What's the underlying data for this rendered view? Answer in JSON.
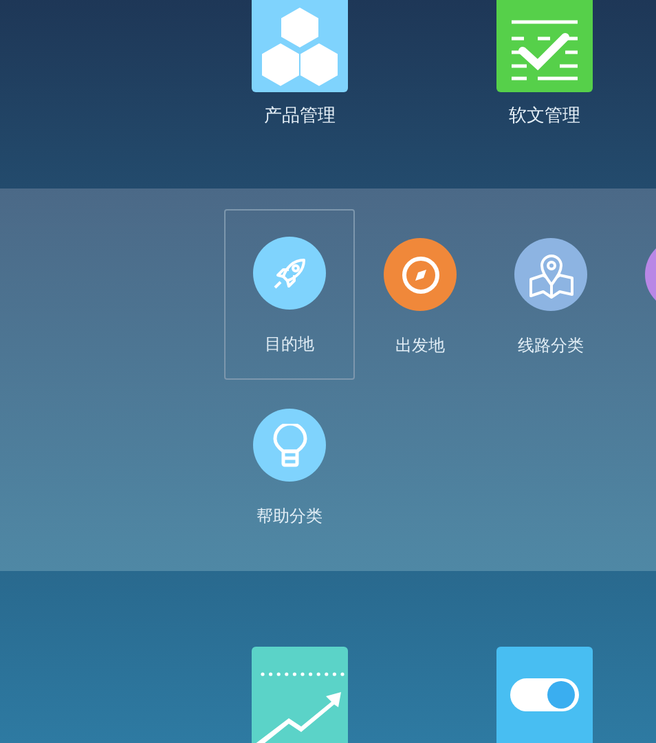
{
  "top_tiles": [
    {
      "label": "产品管理",
      "kind": "cubes",
      "color": "#7fd3fd"
    },
    {
      "label": "软文管理",
      "kind": "checklist",
      "color": "#56d04a"
    }
  ],
  "categories": [
    {
      "label": "目的地",
      "kind": "rocket",
      "color": "#7fd3fd",
      "selected": true
    },
    {
      "label": "出发地",
      "kind": "compass",
      "color": "#f0883a",
      "selected": false
    },
    {
      "label": "线路分类",
      "kind": "map",
      "color": "#8db4e2",
      "selected": false
    },
    {
      "kind": "blank",
      "color": "#b987e6",
      "selected": false
    },
    {
      "label": "帮助分类",
      "kind": "bulb",
      "color": "#7fd3fd",
      "selected": false
    }
  ],
  "bottom_tiles": [
    {
      "kind": "trend",
      "color": "#5bd3c8"
    },
    {
      "kind": "toggle",
      "color": "#48bef2"
    }
  ]
}
